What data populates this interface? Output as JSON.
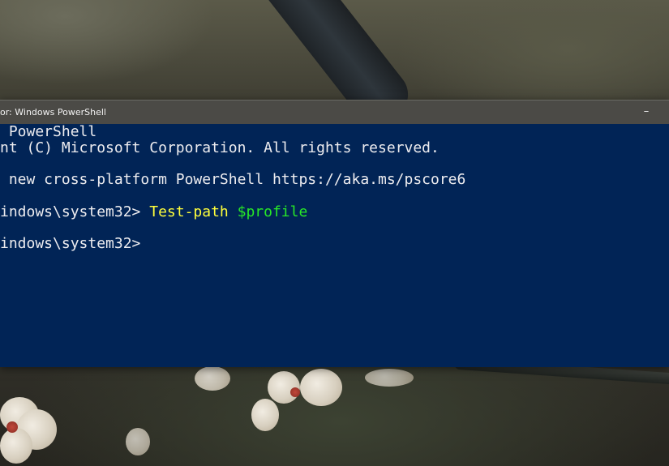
{
  "window": {
    "title": "or: Windows PowerShell",
    "minimize_glyph": "–"
  },
  "console": {
    "lines": [
      {
        "text": " PowerShell"
      },
      {
        "text": "nt (C) Microsoft Corporation. All rights reserved."
      },
      {
        "text": " new cross-platform PowerShell https://aka.ms/pscore6"
      },
      {
        "prompt": "indows\\system32> ",
        "command": "Test-path",
        "space": " ",
        "argument": "$profile"
      },
      {
        "prompt": "indows\\system32>"
      }
    ]
  },
  "colors": {
    "console_bg": "#012456",
    "console_text": "#eeedf0",
    "command_yellow": "#ffff3b",
    "variable_green": "#27e827",
    "titlebar_bg": "#4b4a46"
  },
  "icons": {
    "minimize": "minimize-icon"
  }
}
